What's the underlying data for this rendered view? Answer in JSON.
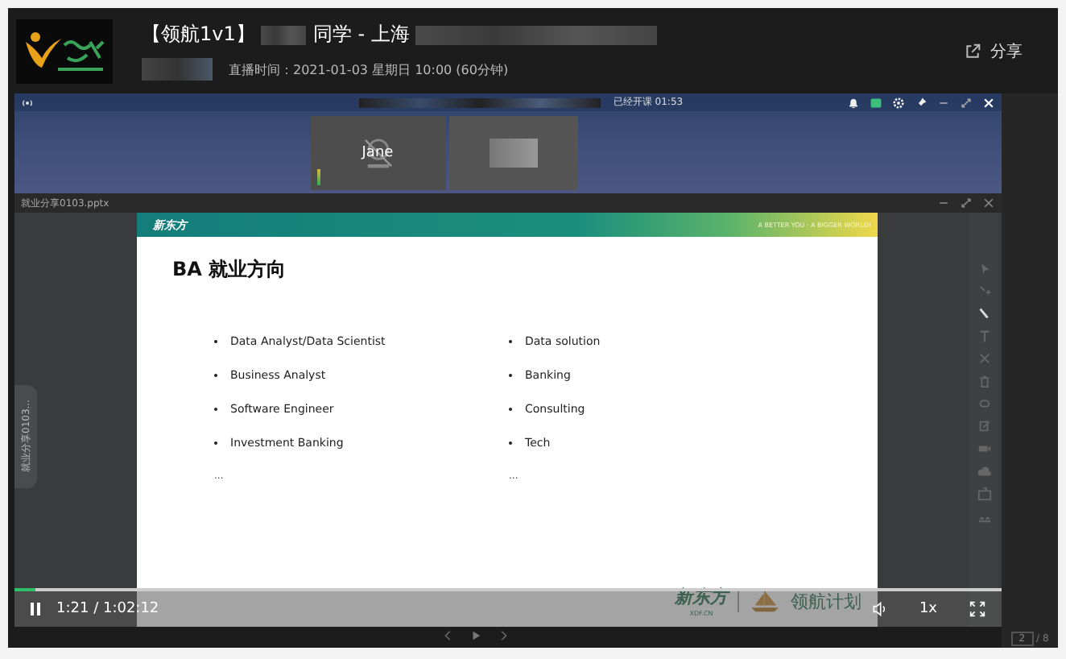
{
  "header": {
    "title_prefix": "【领航1v1】",
    "title_suffix": "同学 - 上海",
    "schedule": "直播时间：2021-01-03 星期日 10:00 (60分钟)",
    "share": "分享"
  },
  "meeting": {
    "status": "已经开课 01:53",
    "participants": [
      {
        "kind": "avatar",
        "name": "Jane"
      },
      {
        "kind": "screen"
      }
    ]
  },
  "document": {
    "filename": "就业分享0103.pptx",
    "side_tab": "就业分享0103...",
    "slide": {
      "brand": "新东方",
      "tagline": "A BETTER YOU · A BIGGER WORLD!",
      "title": "BA 就业方向",
      "columns": [
        {
          "items": [
            "Data Analyst/Data Scientist",
            "Business Analyst",
            "Software Engineer",
            "Investment Banking"
          ],
          "more": "..."
        },
        {
          "items": [
            "Data solution",
            "Banking",
            "Consulting",
            "Tech"
          ],
          "more": "..."
        }
      ],
      "footer_brand": "新东方",
      "footer_brand_sub": "XDF.CN",
      "footer_program": "领航计划"
    }
  },
  "player": {
    "playing": true,
    "level": 0.022,
    "time": "1:21 / 1:02:12",
    "speed": "1x",
    "page": "2",
    "page_total": "/ 8"
  }
}
